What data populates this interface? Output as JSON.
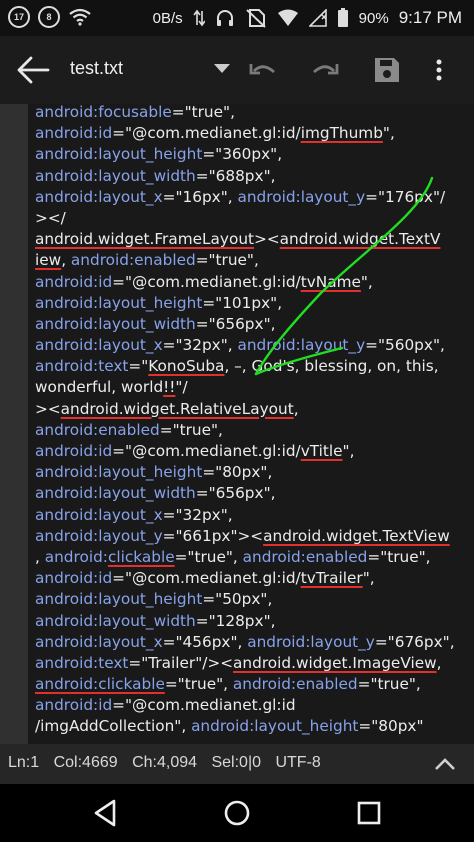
{
  "status_bar": {
    "notification_badge_1": "17",
    "notification_badge_2": "8",
    "data_rate": "0B/s",
    "battery_percent": "90%",
    "time": "9:17 PM"
  },
  "toolbar": {
    "title": "test.txt"
  },
  "code_lines": [
    [
      [
        "a",
        "android:focusable"
      ],
      [
        "s",
        "=\"true\","
      ]
    ],
    [
      [
        "a",
        "android:id"
      ],
      [
        "s",
        "=\"@com.medianet.gl:id/"
      ],
      [
        "su",
        "imgThumb"
      ],
      [
        "s",
        "\","
      ]
    ],
    [
      [
        "a",
        "android:layout_height"
      ],
      [
        "s",
        "=\"360px\","
      ]
    ],
    [
      [
        "a",
        "android:layout_width"
      ],
      [
        "s",
        "=\"688px\","
      ]
    ],
    [
      [
        "a",
        "android:layout_x"
      ],
      [
        "s",
        "=\"16px\", "
      ],
      [
        "a",
        "android:layout_y"
      ],
      [
        "s",
        "=\"176px\"/"
      ]
    ],
    [
      [
        "s",
        "></"
      ]
    ],
    [
      [
        "su",
        "android.widget.FrameLayout"
      ],
      [
        "s",
        "><"
      ],
      [
        "su",
        "android.widget.TextV"
      ]
    ],
    [
      [
        "su",
        "iew"
      ],
      [
        "s",
        ", "
      ],
      [
        "a",
        "android:enabled"
      ],
      [
        "s",
        "=\"true\","
      ]
    ],
    [
      [
        "a",
        "android:id"
      ],
      [
        "s",
        "=\"@com.medianet.gl:id/"
      ],
      [
        "su",
        "tvName"
      ],
      [
        "s",
        "\","
      ]
    ],
    [
      [
        "a",
        "android:layout_height"
      ],
      [
        "s",
        "=\"101px\","
      ]
    ],
    [
      [
        "a",
        "android:layout_width"
      ],
      [
        "s",
        "=\"656px\","
      ]
    ],
    [
      [
        "a",
        "android:layout_x"
      ],
      [
        "s",
        "=\"32px\", "
      ],
      [
        "a",
        "android:layout_y"
      ],
      [
        "s",
        "=\"560px\","
      ]
    ],
    [
      [
        "a",
        "android:text"
      ],
      [
        "s",
        "=\""
      ],
      [
        "su",
        "KonoSuba"
      ],
      [
        "s",
        ", –, God's, blessing, on, this,"
      ]
    ],
    [
      [
        "s",
        "wonderful, world"
      ],
      [
        "su",
        "!!"
      ],
      [
        "s",
        "\"/"
      ]
    ],
    [
      [
        "s",
        "><"
      ],
      [
        "su",
        "android.widget.RelativeLayout"
      ],
      [
        "s",
        ","
      ]
    ],
    [
      [
        "a",
        "android:enabled"
      ],
      [
        "s",
        "=\"true\","
      ]
    ],
    [
      [
        "a",
        "android:id"
      ],
      [
        "s",
        "=\"@com.medianet.gl:id/"
      ],
      [
        "su",
        "vTitle"
      ],
      [
        "s",
        "\","
      ]
    ],
    [
      [
        "a",
        "android:layout_height"
      ],
      [
        "s",
        "=\"80px\","
      ]
    ],
    [
      [
        "a",
        "android:layout_width"
      ],
      [
        "s",
        "=\"656px\","
      ]
    ],
    [
      [
        "a",
        "android:layout_x"
      ],
      [
        "s",
        "=\"32px\","
      ]
    ],
    [
      [
        "a",
        "android:layout_y"
      ],
      [
        "s",
        "=\"661px\"><"
      ],
      [
        "su",
        "android.widget.TextView"
      ]
    ],
    [
      [
        "s",
        ", "
      ],
      [
        "a",
        "android:"
      ],
      [
        "au",
        "clickable"
      ],
      [
        "s",
        "=\"true\", "
      ],
      [
        "a",
        "android:enabled"
      ],
      [
        "s",
        "=\"true\","
      ]
    ],
    [
      [
        "a",
        "android:id"
      ],
      [
        "s",
        "=\"@com.medianet.gl:id/"
      ],
      [
        "su",
        "tvTrailer"
      ],
      [
        "s",
        "\","
      ]
    ],
    [
      [
        "a",
        "android:layout_height"
      ],
      [
        "s",
        "=\"50px\","
      ]
    ],
    [
      [
        "a",
        "android:layout_width"
      ],
      [
        "s",
        "=\"128px\","
      ]
    ],
    [
      [
        "a",
        "android:layout_x"
      ],
      [
        "s",
        "=\"456px\", "
      ],
      [
        "a",
        "android:layout_y"
      ],
      [
        "s",
        "=\"676px\","
      ]
    ],
    [
      [
        "a",
        "android:text"
      ],
      [
        "s",
        "=\"Trailer\"/><"
      ],
      [
        "su",
        "android.widget.ImageView"
      ],
      [
        "s",
        ","
      ]
    ],
    [
      [
        "au",
        "android:clickable"
      ],
      [
        "s",
        "=\"true\", "
      ],
      [
        "a",
        "android:enabled"
      ],
      [
        "s",
        "=\"true\","
      ]
    ],
    [
      [
        "a",
        "android:id"
      ],
      [
        "s",
        "=\"@com.medianet.gl:id"
      ]
    ],
    [
      [
        "s",
        "/imgAddCollection\", "
      ],
      [
        "a",
        "android:layout_height"
      ],
      [
        "s",
        "=\"80px\""
      ]
    ]
  ],
  "status_line": {
    "line": "Ln:1",
    "col": "Col:4669",
    "ch": "Ch:4,094",
    "sel": "Sel:0|0",
    "encoding": "UTF-8"
  },
  "colors": {
    "attribute": "#87a2ea",
    "string": "#ececec",
    "spell_underline": "#e03030",
    "ink_annotation": "#22dd22"
  },
  "icons": [
    "back-arrow-icon",
    "dropdown-icon",
    "undo-icon",
    "redo-icon",
    "save-icon",
    "overflow-menu-icon",
    "nav-back-icon",
    "nav-home-icon",
    "nav-recents-icon",
    "scroll-up-icon"
  ]
}
